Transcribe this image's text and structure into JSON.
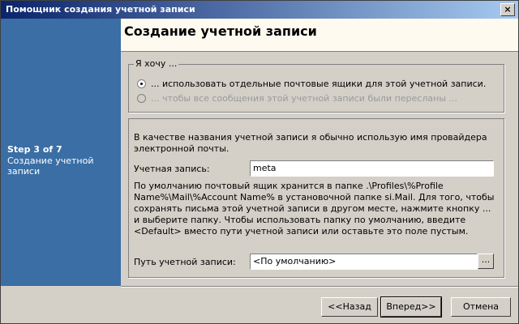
{
  "window": {
    "title": "Помощник создания учетной записи",
    "close_label": "×"
  },
  "sidebar": {
    "step": "Step 3 of 7",
    "step_name": "Создание учетной записи"
  },
  "header": {
    "title": "Создание учетной записи"
  },
  "choice_group": {
    "legend": "Я хочу ...",
    "options": [
      {
        "label": "... использовать отдельные почтовые ящики для этой учетной записи.",
        "checked": true,
        "enabled": true
      },
      {
        "label": "... чтобы все сообщения этой учетной записи были пересланы ...",
        "checked": false,
        "enabled": false
      }
    ]
  },
  "account_group": {
    "intro": "В качестве названия учетной записи я обычно использую имя провайдера электронной почты.",
    "account_label": "Учетная запись:",
    "account_value": "meta",
    "info": "По умолчанию почтовый ящик хранится в папке .\\Profiles\\%Profile Name%\\Mail\\%Account Name% в установочной папке si.Mail. Для того, чтобы сохранять письма этой учетной записи в другом месте, нажмите кнопку ... и выберите папку. Чтобы использовать папку по умолчанию, введите <Default> вместо пути учетной записи или оставьте это поле пустым.",
    "path_label": "Путь учетной записи:",
    "path_value": "<По умолчанию>",
    "browse_label": "..."
  },
  "buttons": {
    "back": "<<Назад",
    "next": "Вперед>>",
    "cancel": "Отмена"
  }
}
